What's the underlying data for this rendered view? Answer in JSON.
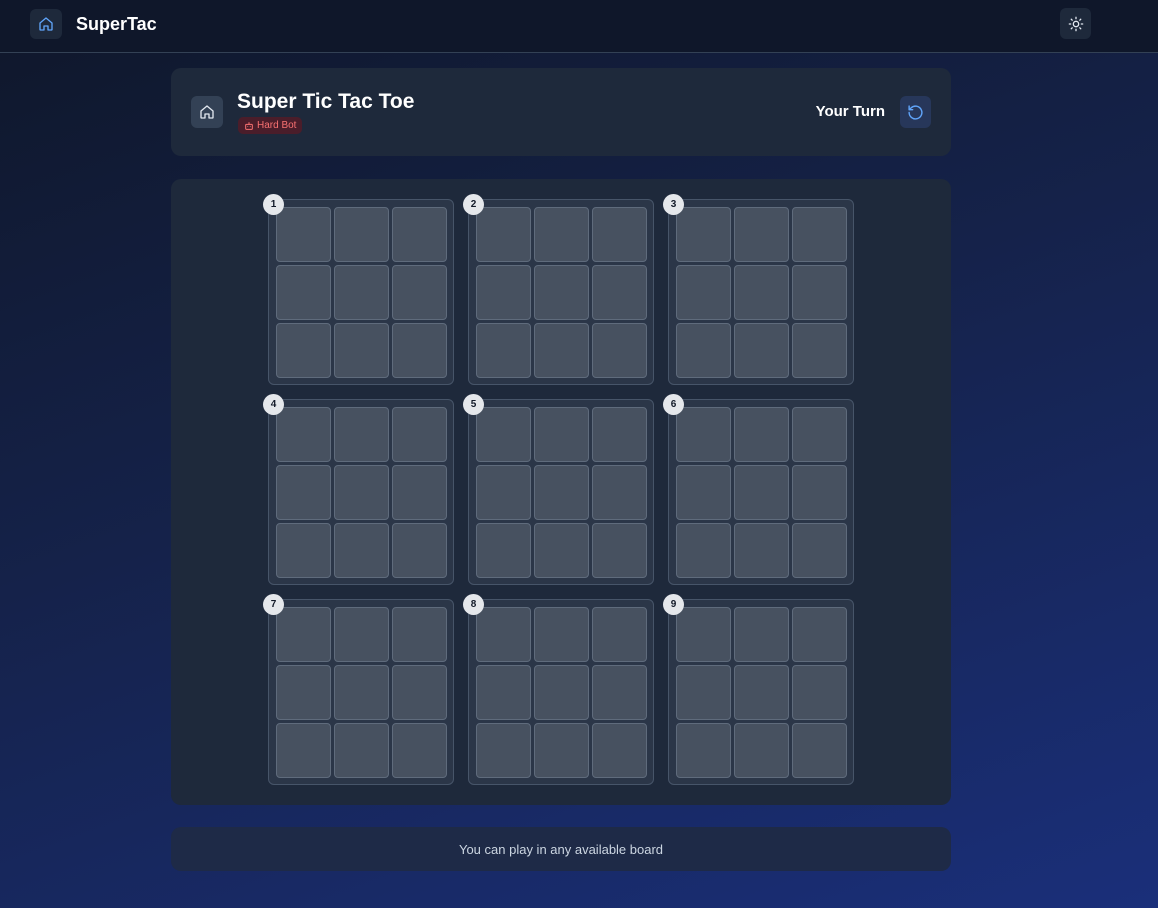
{
  "app": {
    "brand": "SuperTac"
  },
  "header": {
    "title": "Super Tic Tac Toe",
    "badge": "Hard Bot",
    "turn_status": "Your Turn"
  },
  "boards": [
    {
      "number": "1"
    },
    {
      "number": "2"
    },
    {
      "number": "3"
    },
    {
      "number": "4"
    },
    {
      "number": "5"
    },
    {
      "number": "6"
    },
    {
      "number": "7"
    },
    {
      "number": "8"
    },
    {
      "number": "9"
    }
  ],
  "footer": {
    "message": "You can play in any available board"
  },
  "colors": {
    "accent": "#60a5fa",
    "badge_text": "#f87171",
    "cell": "#475160"
  },
  "icons": {
    "nav_home": "home-icon",
    "theme": "sun-icon",
    "back_home": "home-icon",
    "badge": "robot-icon",
    "reset": "rotate-ccw-icon"
  }
}
